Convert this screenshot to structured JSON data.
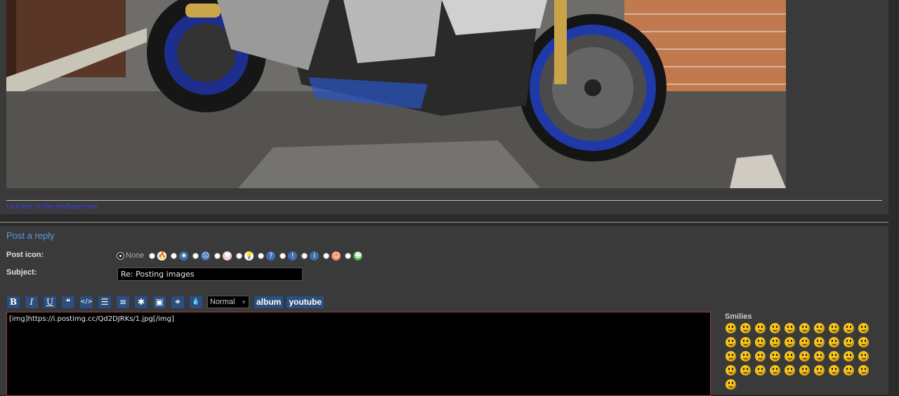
{
  "post": {
    "image_alt": "Yamaha R1 motorcycle with blue wheels parked on a driveway",
    "image_link_text": "Link this to the YouTube here"
  },
  "reply": {
    "title": "Post a reply",
    "post_icon_label": "Post icon:",
    "none_label": "None",
    "post_icons": [
      {
        "name": "fire-icon",
        "glyph": "🔥",
        "bg": "#ffffff"
      },
      {
        "name": "star-icon",
        "glyph": "★",
        "bg": "#3d6fb0"
      },
      {
        "name": "sad-face-icon",
        "glyph": "☹",
        "bg": "#3d6fb0"
      },
      {
        "name": "heart-icon",
        "glyph": "♥",
        "bg": "#f0d0da"
      },
      {
        "name": "lightbulb-icon",
        "glyph": "💡",
        "bg": "#ffffff"
      },
      {
        "name": "question-icon",
        "glyph": "?",
        "bg": "#3d6fb0"
      },
      {
        "name": "warning-icon",
        "glyph": "!",
        "bg": "#3d6fb0"
      },
      {
        "name": "info-icon",
        "glyph": "i",
        "bg": "#3d6fb0"
      },
      {
        "name": "thumbs-icon",
        "glyph": "☺",
        "bg": "#f08a5d"
      },
      {
        "name": "grin-icon",
        "glyph": "☻",
        "bg": "#4caf50"
      }
    ],
    "subject_label": "Subject:",
    "subject_value": "Re: Posting images",
    "toolbar": {
      "bold": "B",
      "italic": "I",
      "underline": "U",
      "quote": "❝",
      "code": "</>",
      "list": "☰",
      "ordered_list": "≡",
      "list_item": "✱",
      "image": "▣",
      "link": "⚭",
      "color": "💧",
      "font_size": "Normal",
      "album": "album",
      "youtube": "youtube"
    },
    "message_value": "[img]https://i.postimg.cc/Qd2DJRKs/1.jpg[/img]",
    "smilies_title": "Smilies",
    "smilies_count": 41
  }
}
